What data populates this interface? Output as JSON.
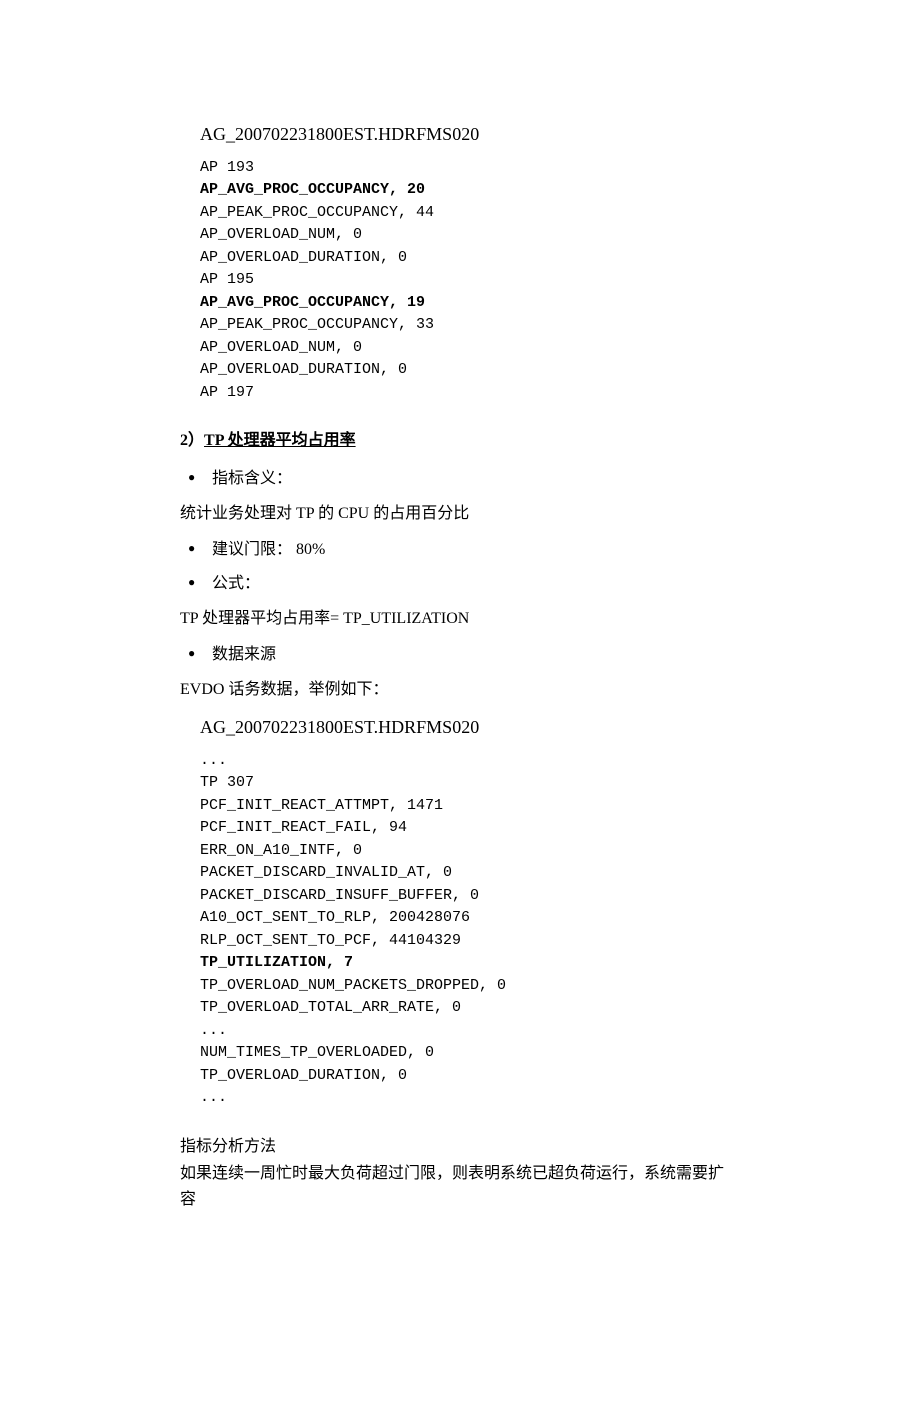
{
  "block1": {
    "header": "AG_200702231800EST.HDRFMS020",
    "l1": "AP 193",
    "l2": "AP_AVG_PROC_OCCUPANCY, 20",
    "l3": "AP_PEAK_PROC_OCCUPANCY, 44",
    "l4": "AP_OVERLOAD_NUM, 0",
    "l5": "AP_OVERLOAD_DURATION, 0",
    "l6": "AP 195",
    "l7": "AP_AVG_PROC_OCCUPANCY, 19",
    "l8": "AP_PEAK_PROC_OCCUPANCY, 33",
    "l9": "AP_OVERLOAD_NUM, 0",
    "l10": "AP_OVERLOAD_DURATION, 0",
    "l11": "AP 197"
  },
  "sec2": {
    "num": "2）",
    "title": "TP 处理器平均占用率",
    "bullet1": "指标含义：",
    "para1": "统计业务处理对 TP 的 CPU 的占用百分比",
    "bullet2": "建议门限： 80%",
    "bullet3": "公式：",
    "para2": "TP 处理器平均占用率= TP_UTILIZATION",
    "bullet4": "数据来源",
    "para3": "EVDO 话务数据，举例如下："
  },
  "block2": {
    "header": "AG_200702231800EST.HDRFMS020",
    "l0": "...",
    "l1": "TP 307",
    "l2": "PCF_INIT_REACT_ATTMPT, 1471",
    "l3": "PCF_INIT_REACT_FAIL, 94",
    "l4": "ERR_ON_A10_INTF, 0",
    "l5": "PACKET_DISCARD_INVALID_AT, 0",
    "l6": "PACKET_DISCARD_INSUFF_BUFFER, 0",
    "l7": "A10_OCT_SENT_TO_RLP, 200428076",
    "l8": "RLP_OCT_SENT_TO_PCF, 44104329",
    "l9": "TP_UTILIZATION, 7",
    "l10": "TP_OVERLOAD_NUM_PACKETS_DROPPED, 0",
    "l11": "TP_OVERLOAD_TOTAL_ARR_RATE, 0",
    "l12": "...",
    "l13": "NUM_TIMES_TP_OVERLOADED, 0",
    "l14": "TP_OVERLOAD_DURATION, 0",
    "l15": "..."
  },
  "footer": {
    "p1": "指标分析方法",
    "p2a": "如果连续一周忙时最大负荷超过",
    "p2b": "门限",
    "p2c": "，则表明系统已超负荷运行，系统需要扩容"
  }
}
